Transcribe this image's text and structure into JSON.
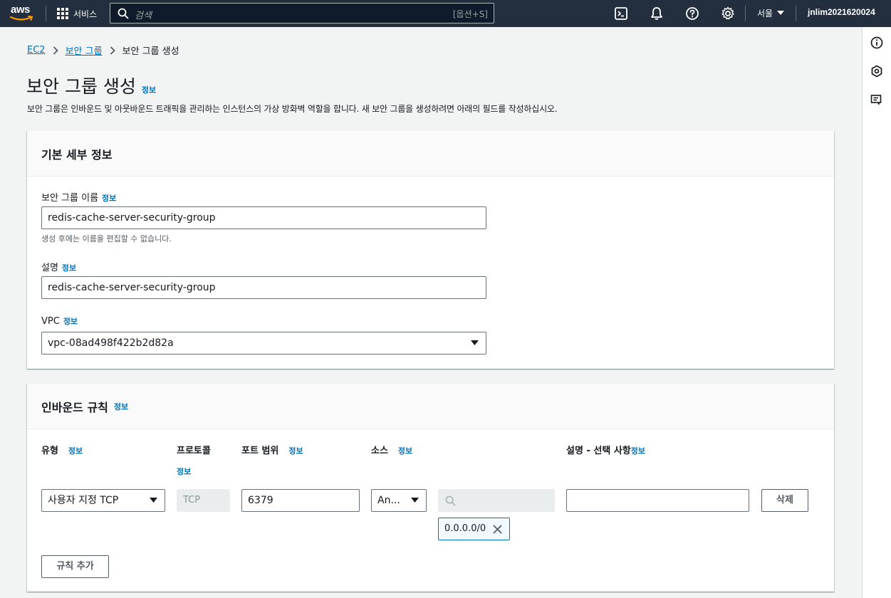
{
  "topnav": {
    "logo": "aws",
    "services_label": "서비스",
    "search_placeholder": "검색",
    "search_shortcut": "[옵션+S]",
    "region": "서울",
    "account": "jnlim2021620024",
    "icons": [
      "cloudshell-icon",
      "notifications-icon",
      "help-icon",
      "settings-icon"
    ]
  },
  "breadcrumb": [
    "EC2",
    "보안 그룹",
    "보안 그룹 생성"
  ],
  "page": {
    "title": "보안 그룹 생성",
    "info": "정보",
    "description": "보안 그룹은 인바운드 및 아웃바운드 트래픽을 관리하는 인스턴스의 가상 방화벽 역할을 합니다. 새 보안 그룹을 생성하려면 아래의 필드를 작성하십시오."
  },
  "basic": {
    "header": "기본 세부 정보",
    "name_label": "보안 그룹 이름",
    "name_value": "redis-cache-server-security-group",
    "name_hint": "생성 후에는 이름을 편집할 수 없습니다.",
    "desc_label": "설명",
    "desc_value": "redis-cache-server-security-group",
    "vpc_label": "VPC",
    "vpc_value": "vpc-08ad498f422b2d82a"
  },
  "inbound": {
    "header": "인바운드 규칙",
    "columns": {
      "type": "유형",
      "protocol": "프로토콜",
      "port": "포트 범위",
      "source": "소스",
      "description": "설명 - 선택 사항"
    },
    "rule": {
      "type": "사용자 지정 TCP",
      "protocol": "TCP",
      "port": "6379",
      "source_type": "An...",
      "source_search_placeholder": "",
      "source_token": "0.0.0.0/0",
      "description": "",
      "delete_label": "삭제"
    },
    "add_rule_label": "규칙 추가"
  },
  "colors": {
    "nav_bg": "#232f3e",
    "link": "#0073bb",
    "accent": "#ff9900"
  }
}
